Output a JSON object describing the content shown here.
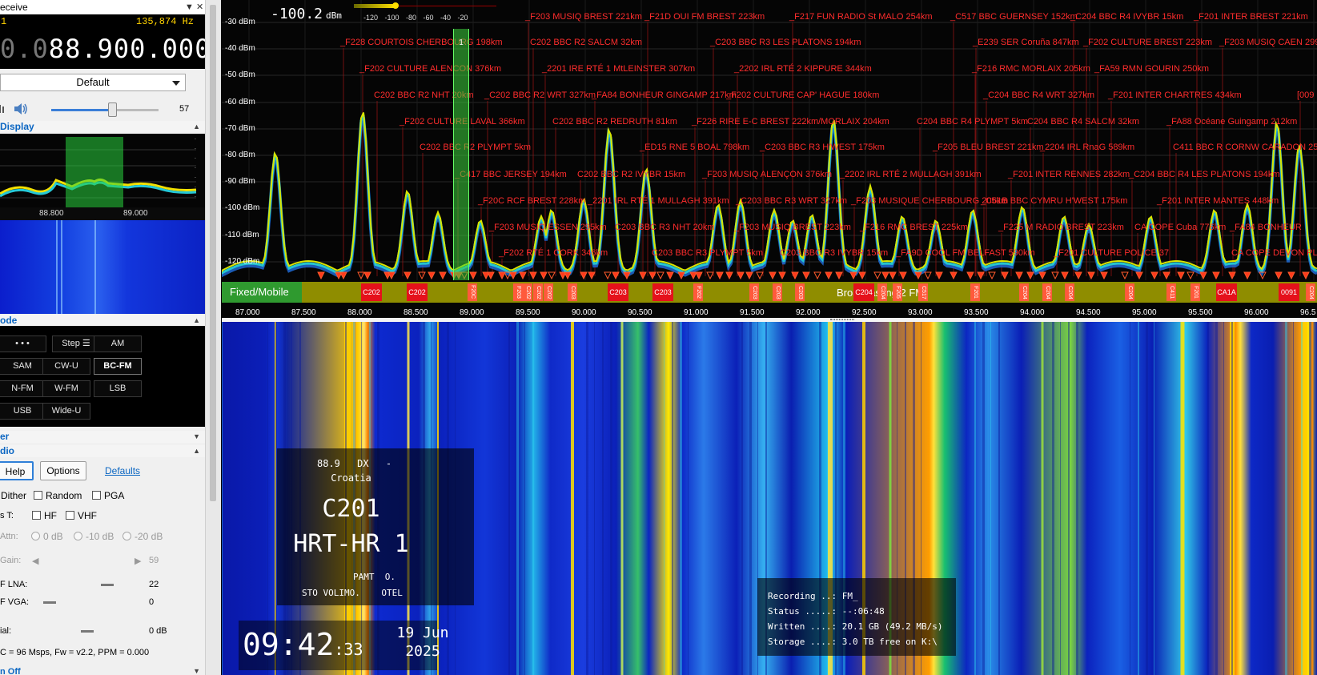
{
  "left_panel": {
    "title": "eceive",
    "title_prefix": "1",
    "offset_hz": "135,874 Hz",
    "freq_dim": "0.0",
    "freq_main": "88.900.000",
    "profile": "Default",
    "volume": 57,
    "display_header": "Display",
    "mini_axis": [
      "88.800",
      "89.000"
    ],
    "mode_header": "ode",
    "mode_buttons": [
      "• • •",
      "Step ☰",
      "AM",
      "SAM",
      "CW-U",
      "BC-FM",
      "N-FM",
      "W-FM",
      "LSB",
      "USB",
      "Wide-U"
    ],
    "active_mode": "BC-FM",
    "filter_header": "er",
    "radio_header": "dio",
    "help_label": "Help",
    "options_label": "Options",
    "defaults_label": "Defaults",
    "dither_label": "Dither",
    "random_label": "Random",
    "pga_label": "PGA",
    "t_label": "s T:",
    "hf_label": "HF",
    "vhf_label": "VHF",
    "attn_label": "Attn:",
    "attn_options": [
      "0 dB",
      "-10 dB",
      "-20 dB"
    ],
    "gain_label": "Gain:",
    "gain_value": "59",
    "lna_label": "F LNA:",
    "lna_value": "22",
    "vga_label": "F VGA:",
    "vga_value": "0",
    "ial_label": "ial:",
    "ial_value": "0 dB",
    "status_line": "C = 96 Msps, Fw = v2.2, PPM = 0.000",
    "bottom_section": "n Off"
  },
  "spectrum": {
    "level": "-100.2",
    "level_unit": "dBm",
    "meter_labels": "-120 -100 -80 -60 -40 -20",
    "db_labels": [
      "-30 dBm",
      "-40 dBm",
      "-50 dBm",
      "-60 dBm",
      "-70 dBm",
      "-80 dBm",
      "-90 dBm",
      "-100 dBm",
      "-110 dBm",
      "-120 dBm"
    ],
    "freq_ticks": [
      "87.000",
      "87.500",
      "88.000",
      "88.500",
      "89.000",
      "89.500",
      "90.000",
      "90.500",
      "91.000",
      "91.500",
      "92.000",
      "92.500",
      "93.000",
      "93.500",
      "94.000",
      "94.500",
      "95.000",
      "95.500",
      "96.000",
      "96.5"
    ],
    "band_fixed": "Fixed/Mobile",
    "band_bcast": "Broadcasting 2 FM",
    "channel_number": "1",
    "band_tags": [
      "C202",
      "C202",
      "F20C",
      "F203",
      "C202",
      "C202",
      "C202",
      "C203",
      "C203",
      "C203",
      "F202",
      "C203",
      "C203",
      "C203",
      "C204",
      "C204",
      "F205",
      "C517",
      "F201",
      "C204",
      "C204",
      "C204",
      "C204",
      "C411",
      "F201",
      "CA1A",
      "0091",
      "C204"
    ],
    "stations": [
      "_F203 MUSIQ BREST 221km",
      "_F21D OUI FM BREST 223km",
      "_F217 FUN RADIO St MALO 254km",
      "_C517 BBC GUERNSEY 152km",
      "_C204 BBC R4 IVYBR 15km",
      "_F201 INTER BREST 221km",
      "_F228 COURTOIS CHERBOURG 198km",
      "C202 BBC R2 SALCM 32km",
      "_C203 BBC R3 LES PLATONS 194km",
      "_E239 SER Coruña 847km",
      "_F202 CULTURE BREST 223km",
      "_F203 MUSIQ CAEN 299",
      "_F202 CULTURE ALENCON 376km",
      "_2201 IRE RTÉ 1 MtLEINSTER 307km",
      "_2202 IRL RTÉ 2 KIPPURE 344km",
      "_F216 RMC MORLAIX 205km",
      "_FA59 RMN GOURIN 250km",
      "C202 BBC R2 NHT 20km",
      "_C202 BBC R2 WRT 327km",
      "_FA84 BONHEUR GINGAMP 217km",
      "_F202 CULTURE CAP' HAGUE 180km",
      "_C204 BBC R4 WRT 327km",
      "_F201 INTER CHARTRES 434km",
      "[009",
      "_F202 CULTURE LAVAL 366km",
      "C202 BBC R2 REDRUTH 81km",
      "_F226 RIRE E-C BREST 222km/MORLAIX 204km",
      "C204 BBC R4 PLYMPT 5km",
      "C204 BBC R4 SALCM 32km",
      "_FA88 Océane Guingamp 212km",
      "C202 BBC R2 PLYMPT 5km",
      "_ED15 RNE 5 BOAL 798km",
      "_C203 BBC R3 H'WEST 175km",
      "_F205 BLEU BREST 221km",
      "_2204 IRL RnaG 589km",
      "C411 BBC R CORNW CARADON 25k",
      "_C417 BBC JERSEY 194km",
      "C202 BBC R2 IVYBR 15km",
      "_F203 MUSIQ ALENÇON 376km",
      "_2202 IRL RTÉ 2 MULLAGH 391km",
      "_F201 INTER RENNES 282km",
      "_C204 BBC R4 LES PLATONS 194km",
      "_F20C RCF BREST 228km",
      "_2201 IRL RTÉ 1 MULLAGH 391km",
      "_C203 BBC R3 WRT 327km",
      "_F203 MUSIQUE CHERBOURG 205km",
      "_C61B BBC CYMRU H'WEST 175km",
      "_F201 INTER MANTES 448km",
      "_F203 MUSIQ ESSEN 295km",
      "C203 BBC R3 NHT 20km",
      "_F203 MUSIQ BREST 223km",
      "_F216 RMC BREST 225km",
      "_F225 M RADIO BREST 223km",
      "CA COPE Cuba 776km",
      "_FA84 BONHEUR",
      "_F202 RTÉ 1 CORK 346km",
      "C203 BBC R3 PLYMPT 5km",
      "C203 BBC R3 IVYBR 15km",
      "_FA9D COOL FM BELFAST 590km",
      "_F201 CULTURE POLICE 37",
      "CA COPE DEVON PL"
    ]
  },
  "waterfall": {
    "rds_freq": "88.9",
    "rds_dx": "DX",
    "rds_dash": "-",
    "rds_country": "Croatia",
    "rds_pi": "C201",
    "rds_ps": "HRT-HR 1",
    "rds_rt1": "PAMT  O.",
    "rds_rt2": "STO VOLIMO.    OTEL",
    "clock_hm": "09:42",
    "clock_s": ":33",
    "date_day": "19 Jun",
    "date_year": "2025",
    "rec_recording": "Recording ..: FM_",
    "rec_status": "Status .....: --:06:48",
    "rec_written": "Written ....: 20.1 GB (49.2 MB/s)",
    "rec_storage": "Storage ....: 3.0 TB free on K:\\"
  },
  "colors": {
    "accent": "#0b66c2",
    "station_text": "#ff2d2d",
    "band_tag": "#e5111b",
    "band_bar": "#8f8d00",
    "band_fixed": "#2f9a2f"
  }
}
